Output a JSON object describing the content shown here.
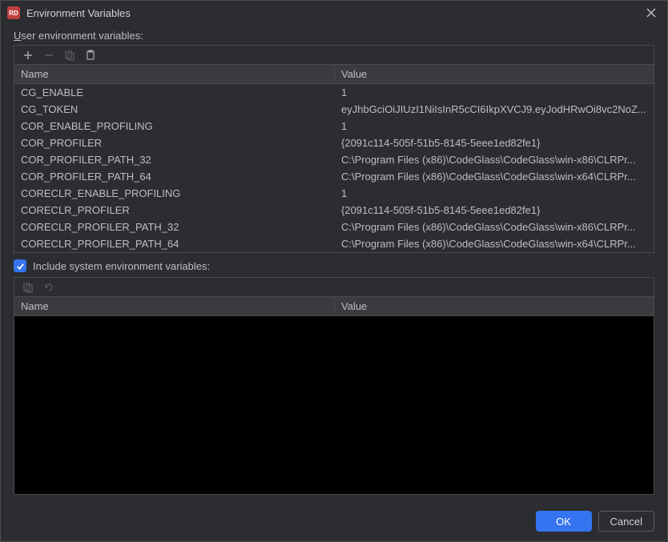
{
  "title": "Environment Variables",
  "app_icon_text": "RD",
  "user_section_label_prefix": "U",
  "user_section_label_rest": "ser environment variables:",
  "headers": {
    "name": "Name",
    "value": "Value"
  },
  "user_vars": [
    {
      "name": "CG_ENABLE",
      "value": "1"
    },
    {
      "name": "CG_TOKEN",
      "value": "eyJhbGciOiJIUzI1NiIsInR5cCI6IkpXVCJ9.eyJodHRwOi8vc2NoZ..."
    },
    {
      "name": "COR_ENABLE_PROFILING",
      "value": "1"
    },
    {
      "name": "COR_PROFILER",
      "value": "{2091c114-505f-51b5-8145-5eee1ed82fe1}"
    },
    {
      "name": "COR_PROFILER_PATH_32",
      "value": "C:\\Program Files (x86)\\CodeGlass\\CodeGlass\\win-x86\\CLRPr..."
    },
    {
      "name": "COR_PROFILER_PATH_64",
      "value": "C:\\Program Files (x86)\\CodeGlass\\CodeGlass\\win-x64\\CLRPr..."
    },
    {
      "name": "CORECLR_ENABLE_PROFILING",
      "value": "1"
    },
    {
      "name": "CORECLR_PROFILER",
      "value": "{2091c114-505f-51b5-8145-5eee1ed82fe1}"
    },
    {
      "name": "CORECLR_PROFILER_PATH_32",
      "value": "C:\\Program Files (x86)\\CodeGlass\\CodeGlass\\win-x86\\CLRPr..."
    },
    {
      "name": "CORECLR_PROFILER_PATH_64",
      "value": "C:\\Program Files (x86)\\CodeGlass\\CodeGlass\\win-x64\\CLRPr..."
    }
  ],
  "include_system_label": "Include system environment variables:",
  "include_system_checked": true,
  "system_vars": [],
  "buttons": {
    "ok": "OK",
    "cancel": "Cancel"
  }
}
